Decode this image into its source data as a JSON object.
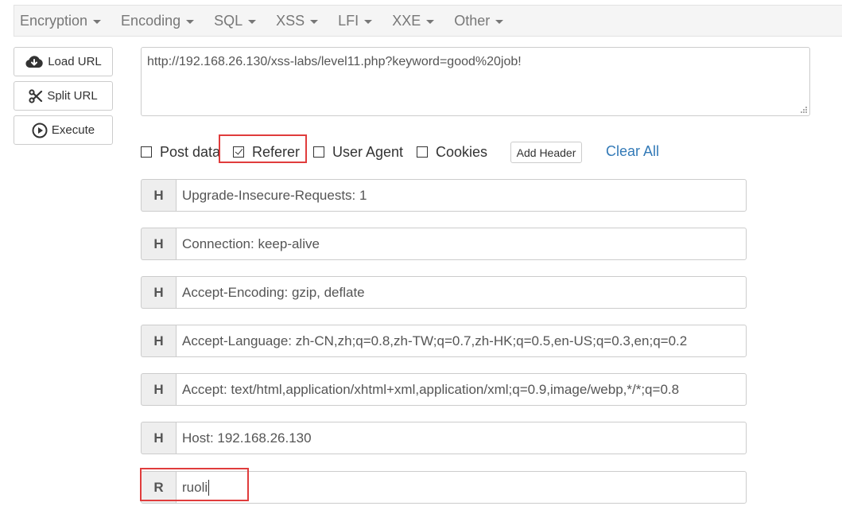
{
  "menu": [
    {
      "label": "Encryption"
    },
    {
      "label": "Encoding"
    },
    {
      "label": "SQL"
    },
    {
      "label": "XSS"
    },
    {
      "label": "LFI"
    },
    {
      "label": "XXE"
    },
    {
      "label": "Other"
    }
  ],
  "buttons": {
    "load_url": {
      "label": "Load URL",
      "icon": "cloud-download-icon"
    },
    "split_url": {
      "label": "Split URL",
      "icon": "scissors-icon"
    },
    "execute": {
      "label": "Execute",
      "icon": "play-circle-icon"
    }
  },
  "url": {
    "value": "http://192.168.26.130/xss-labs/level11.php?keyword=good%20job!"
  },
  "options": {
    "post_data": {
      "label": "Post data",
      "checked": false
    },
    "referer": {
      "label": "Referer",
      "checked": true
    },
    "user_agent": {
      "label": "User Agent",
      "checked": false
    },
    "cookies": {
      "label": "Cookies",
      "checked": false
    },
    "add_header": "Add Header",
    "clear_all": "Clear All"
  },
  "headers": [
    {
      "badge": "H",
      "value": "Upgrade-Insecure-Requests: 1"
    },
    {
      "badge": "H",
      "value": "Connection: keep-alive"
    },
    {
      "badge": "H",
      "value": "Accept-Encoding: gzip, deflate"
    },
    {
      "badge": "H",
      "value": "Accept-Language: zh-CN,zh;q=0.8,zh-TW;q=0.7,zh-HK;q=0.5,en-US;q=0.3,en;q=0.2"
    },
    {
      "badge": "H",
      "value": "Accept: text/html,application/xhtml+xml,application/xml;q=0.9,image/webp,*/*;q=0.8"
    },
    {
      "badge": "H",
      "value": "Host: 192.168.26.130"
    },
    {
      "badge": "R",
      "value": "ruoli"
    }
  ],
  "colors": {
    "link": "#337ab7",
    "highlight": "#e03c3c",
    "menu_text": "#777777"
  }
}
